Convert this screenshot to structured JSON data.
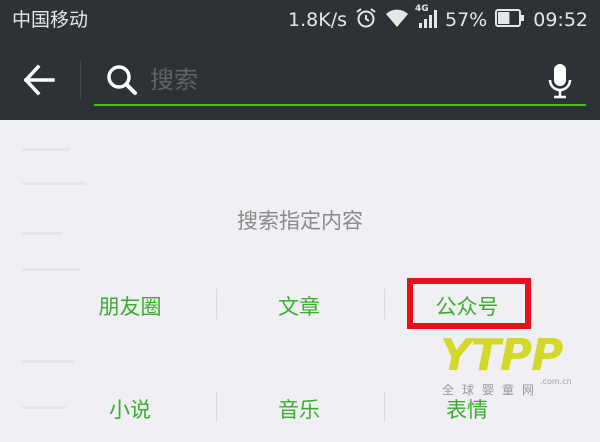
{
  "status_bar": {
    "carrier": "中国移动",
    "net_speed": "1.8K/s",
    "network_type": "4G",
    "battery_percent": "57%",
    "battery_level": 0.57,
    "time": "09:52",
    "icons": [
      "alarm-icon",
      "wifi-icon",
      "signal-icon",
      "battery-icon"
    ]
  },
  "search": {
    "placeholder": "搜索",
    "value": "",
    "accent_color": "#45c01a"
  },
  "main": {
    "section_title": "搜索指定内容",
    "categories": [
      {
        "label": "朋友圈"
      },
      {
        "label": "文章"
      },
      {
        "label": "公众号",
        "highlighted": true
      },
      {
        "label": "小说"
      },
      {
        "label": "音乐"
      },
      {
        "label": "表情"
      }
    ],
    "highlight_color": "#e8101a",
    "category_color": "#3aad2c"
  },
  "watermark": {
    "logo": "YTPP",
    "domain": ".com.cn",
    "subtitle": "全球婴童网"
  }
}
